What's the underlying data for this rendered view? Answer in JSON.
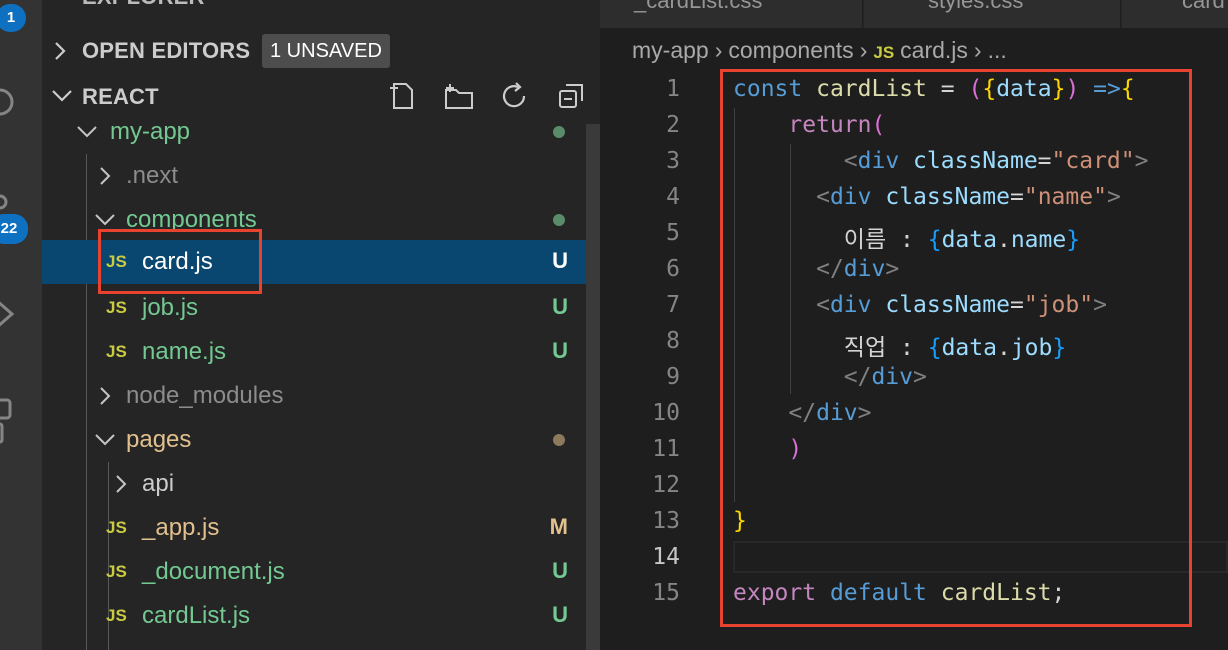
{
  "activity_bar": {
    "explorer_badge": "1",
    "scm_badge": "22",
    "icons": [
      "files-icon",
      "search-icon",
      "source-control-icon",
      "run-icon",
      "extensions-icon"
    ]
  },
  "sidebar": {
    "header_partial": "EXPLORER",
    "open_editors_label": "OPEN EDITORS",
    "unsaved_badge": "1 UNSAVED",
    "workspace_label": "REACT",
    "toolbar_icons": [
      "new-file-icon",
      "new-folder-icon",
      "refresh-icon",
      "collapse-all-icon"
    ],
    "tree": [
      {
        "label": "my-app",
        "type": "folder",
        "expanded": true,
        "status_dot": "green"
      },
      {
        "label": ".next",
        "type": "folder",
        "expanded": false
      },
      {
        "label": "components",
        "type": "folder",
        "expanded": true,
        "status_dot": "green"
      },
      {
        "label": "card.js",
        "type": "js",
        "status": "U",
        "selected": true
      },
      {
        "label": "job.js",
        "type": "js",
        "status": "U"
      },
      {
        "label": "name.js",
        "type": "js",
        "status": "U"
      },
      {
        "label": "node_modules",
        "type": "folder",
        "expanded": false
      },
      {
        "label": "pages",
        "type": "folder",
        "expanded": true,
        "status_dot": "tan"
      },
      {
        "label": "api",
        "type": "folder",
        "expanded": false
      },
      {
        "label": "_app.js",
        "type": "js",
        "status": "M"
      },
      {
        "label": "_document.js",
        "type": "js",
        "status": "U"
      },
      {
        "label": "cardList.js",
        "type": "js",
        "status": "U"
      }
    ],
    "js_icon_label": "JS"
  },
  "editor": {
    "tabs": [
      "_cardList.css",
      "styles.css",
      "card"
    ],
    "breadcrumb": [
      "my-app",
      "components",
      "card.js",
      "..."
    ],
    "breadcrumb_js_label": "JS",
    "lines": [
      {
        "n": "1",
        "text": "const cardList = ({data}) =>{"
      },
      {
        "n": "2",
        "text": "    return("
      },
      {
        "n": "3",
        "text": "        <div className=\"card\">"
      },
      {
        "n": "4",
        "text": "      <div className=\"name\">"
      },
      {
        "n": "5",
        "text": "        이름 : {data.name}"
      },
      {
        "n": "6",
        "text": "      </div>"
      },
      {
        "n": "7",
        "text": "      <div className=\"job\">"
      },
      {
        "n": "8",
        "text": "        직업 : {data.job}"
      },
      {
        "n": "9",
        "text": "        </div>"
      },
      {
        "n": "10",
        "text": "    </div>"
      },
      {
        "n": "11",
        "text": "    )"
      },
      {
        "n": "12",
        "text": ""
      },
      {
        "n": "13",
        "text": "}"
      },
      {
        "n": "14",
        "text": ""
      },
      {
        "n": "15",
        "text": "export default cardList;"
      }
    ],
    "current_line": "14"
  },
  "colors": {
    "annotation_red": "#e8432e",
    "selection_bg": "#094771",
    "untracked_green": "#73c991",
    "modified_tan": "#e2c08d",
    "js_yellow": "#cbcb41"
  }
}
